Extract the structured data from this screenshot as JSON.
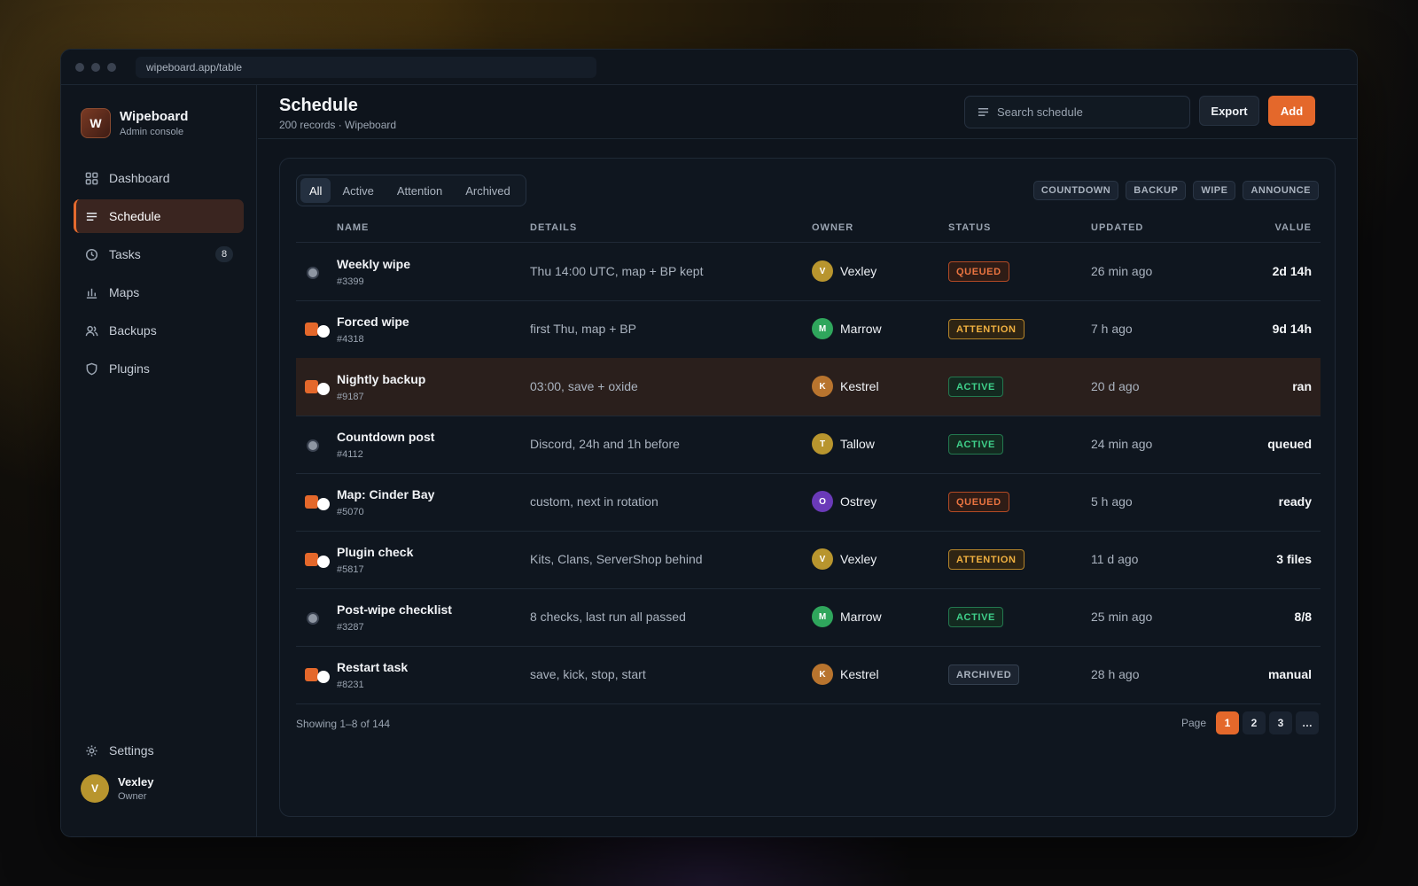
{
  "browser": {
    "url": "wipeboard.app/table"
  },
  "brand": {
    "logo_letter": "W",
    "name": "Wipeboard",
    "subtitle": "Admin console"
  },
  "sidebar": {
    "items": [
      {
        "label": "Dashboard",
        "icon": "grid-icon",
        "active": false
      },
      {
        "label": "Schedule",
        "icon": "list-icon",
        "active": true
      },
      {
        "label": "Tasks",
        "icon": "clock-icon",
        "active": false,
        "badge": "8"
      },
      {
        "label": "Maps",
        "icon": "bar-chart-icon",
        "active": false
      },
      {
        "label": "Backups",
        "icon": "users-icon",
        "active": false
      },
      {
        "label": "Plugins",
        "icon": "shield-icon",
        "active": false
      }
    ],
    "settings_label": "Settings",
    "user": {
      "initial": "V",
      "name": "Vexley",
      "role": "Owner"
    }
  },
  "header": {
    "title": "Schedule",
    "subtitle": "200 records · Wipeboard",
    "search_placeholder": "Search schedule",
    "export_label": "Export",
    "add_label": "Add"
  },
  "tabs": [
    "All",
    "Active",
    "Attention",
    "Archived"
  ],
  "chips": [
    "COUNTDOWN",
    "BACKUP",
    "WIPE",
    "ANNOUNCE"
  ],
  "columns": [
    "NAME",
    "DETAILS",
    "OWNER",
    "STATUS",
    "UPDATED",
    "VALUE"
  ],
  "rows": [
    {
      "name": "Weekly wipe",
      "id": "#3399",
      "details": "Thu 14:00 UTC, map + BP kept",
      "owner": "Vexley",
      "owner_initial": "V",
      "owner_color": "#b8952e",
      "status": "QUEUED",
      "updated": "26 min ago",
      "value": "2d 14h",
      "selected": false
    },
    {
      "name": "Forced wipe",
      "id": "#4318",
      "details": "first Thu, map + BP",
      "owner": "Marrow",
      "owner_initial": "M",
      "owner_color": "#2fa65c",
      "status": "ATTENTION",
      "updated": "7 h ago",
      "value": "9d 14h",
      "selected": true
    },
    {
      "name": "Nightly backup",
      "id": "#9187",
      "details": "03:00, save + oxide",
      "owner": "Kestrel",
      "owner_initial": "K",
      "owner_color": "#b8742e",
      "status": "ACTIVE",
      "updated": "20 d ago",
      "value": "ran",
      "selected": true,
      "highlighted": true
    },
    {
      "name": "Countdown post",
      "id": "#4112",
      "details": "Discord, 24h and 1h before",
      "owner": "Tallow",
      "owner_initial": "T",
      "owner_color": "#b8952e",
      "status": "ACTIVE",
      "updated": "24 min ago",
      "value": "queued",
      "selected": false
    },
    {
      "name": "Map: Cinder Bay",
      "id": "#5070",
      "details": "custom, next in rotation",
      "owner": "Ostrey",
      "owner_initial": "O",
      "owner_color": "#6a3ab8",
      "status": "QUEUED",
      "updated": "5 h ago",
      "value": "ready",
      "selected": true
    },
    {
      "name": "Plugin check",
      "id": "#5817",
      "details": "Kits, Clans, ServerShop behind",
      "owner": "Vexley",
      "owner_initial": "V",
      "owner_color": "#b8952e",
      "status": "ATTENTION",
      "updated": "11 d ago",
      "value": "3 files",
      "selected": true
    },
    {
      "name": "Post-wipe checklist",
      "id": "#3287",
      "details": "8 checks, last run all passed",
      "owner": "Marrow",
      "owner_initial": "M",
      "owner_color": "#2fa65c",
      "status": "ACTIVE",
      "updated": "25 min ago",
      "value": "8/8",
      "selected": false
    },
    {
      "name": "Restart task",
      "id": "#8231",
      "details": "save, kick, stop, start",
      "owner": "Kestrel",
      "owner_initial": "K",
      "owner_color": "#b8742e",
      "status": "ARCHIVED",
      "updated": "28 h ago",
      "value": "manual",
      "selected": true
    }
  ],
  "footer": {
    "showing": "Showing 1–8 of 144",
    "page_label": "Page",
    "pages": [
      "1",
      "2",
      "3",
      "…"
    ],
    "current_page": "1"
  },
  "colors": {
    "accent": "#e4682b",
    "background": "#0e141c"
  }
}
